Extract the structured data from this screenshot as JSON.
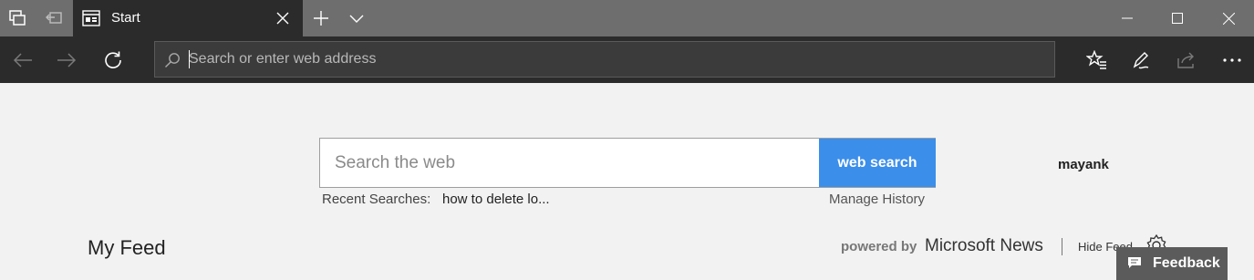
{
  "tab": {
    "title": "Start"
  },
  "address_bar": {
    "placeholder": "Search or enter web address"
  },
  "search": {
    "placeholder": "Search the web",
    "button_label": "web search"
  },
  "user": {
    "name": "mayank"
  },
  "recent": {
    "label": "Recent Searches:",
    "items": [
      "how to delete lo..."
    ],
    "manage_label": "Manage History"
  },
  "feed": {
    "title": "My Feed",
    "powered_by": "powered by",
    "brand": "Microsoft News",
    "hide_label": "Hide Feed"
  },
  "feedback": {
    "label": "Feedback"
  },
  "icons": {
    "tab_set_aside": "tabs-aside-icon",
    "tab_restore": "restore-tabs-icon",
    "new_tab": "plus-icon",
    "tab_preview": "chevron-down-icon"
  },
  "colors": {
    "accent": "#3b8eea",
    "chrome_dark": "#2b2b2b",
    "titlebar": "#6e6e6e"
  }
}
